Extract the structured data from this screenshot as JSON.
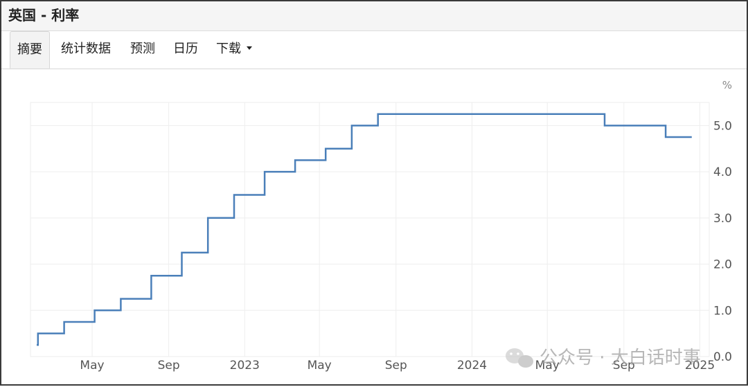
{
  "window": {
    "title": "英国 - 利率"
  },
  "tabs": [
    {
      "label": "摘要",
      "active": true
    },
    {
      "label": "统计数据",
      "active": false
    },
    {
      "label": "预测",
      "active": false
    },
    {
      "label": "日历",
      "active": false
    },
    {
      "label": "下载",
      "active": false,
      "has_dropdown": true
    }
  ],
  "watermark": {
    "text": "公众号 · 大白话时事",
    "icon": "wechat-icon"
  },
  "colors": {
    "line": "#4a7fb9",
    "grid": "#eeeeee",
    "axis_text": "#555555"
  },
  "chart_data": {
    "type": "line",
    "step": true,
    "unit_label": "%",
    "y_axis_side": "right",
    "ylim": [
      0,
      5.5
    ],
    "y_ticks": [
      "0.0",
      "1.0",
      "2.0",
      "3.0",
      "4.0",
      "5.0"
    ],
    "x_ticks": [
      "May",
      "Sep",
      "2023",
      "May",
      "Sep",
      "2024",
      "May",
      "Sep",
      "2025"
    ],
    "grid": true,
    "series": [
      {
        "points": [
          {
            "date": "2022-02-01",
            "value": 0.25
          },
          {
            "date": "2022-02-03",
            "value": 0.5
          },
          {
            "date": "2022-03-17",
            "value": 0.75
          },
          {
            "date": "2022-05-05",
            "value": 1.0
          },
          {
            "date": "2022-06-16",
            "value": 1.25
          },
          {
            "date": "2022-08-04",
            "value": 1.75
          },
          {
            "date": "2022-09-22",
            "value": 2.25
          },
          {
            "date": "2022-11-03",
            "value": 3.0
          },
          {
            "date": "2022-12-15",
            "value": 3.5
          },
          {
            "date": "2023-02-02",
            "value": 4.0
          },
          {
            "date": "2023-03-23",
            "value": 4.25
          },
          {
            "date": "2023-05-11",
            "value": 4.5
          },
          {
            "date": "2023-06-22",
            "value": 5.0
          },
          {
            "date": "2023-08-03",
            "value": 5.25
          },
          {
            "date": "2024-08-01",
            "value": 5.0
          },
          {
            "date": "2024-11-07",
            "value": 4.75
          },
          {
            "date": "2024-12-19",
            "value": 4.75
          }
        ]
      }
    ]
  }
}
